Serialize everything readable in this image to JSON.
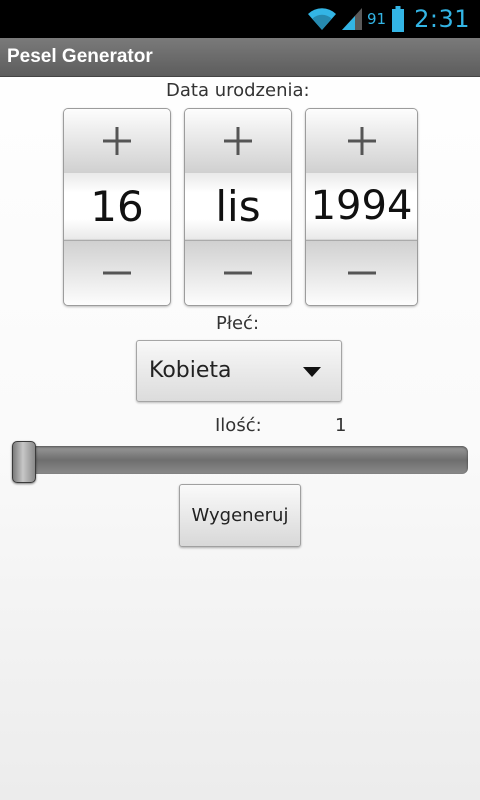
{
  "status_bar": {
    "battery_level": "91",
    "time": "2:31",
    "icons": [
      "wifi-icon",
      "signal-icon",
      "battery-icon"
    ],
    "accent_color": "#33b5e5"
  },
  "title_bar": {
    "title": "Pesel Generator"
  },
  "birth_date": {
    "label": "Data urodzenia:",
    "day": "16",
    "month": "lis",
    "year": "1994",
    "increment_icon": "plus-icon",
    "decrement_icon": "minus-icon"
  },
  "gender": {
    "label": "Płeć:",
    "selected": "Kobieta",
    "icon": "chevron-down-icon"
  },
  "count": {
    "label": "Ilość:",
    "value": "1",
    "slider_value_fraction": 0
  },
  "generate_button": {
    "label": "Wygeneruj"
  }
}
